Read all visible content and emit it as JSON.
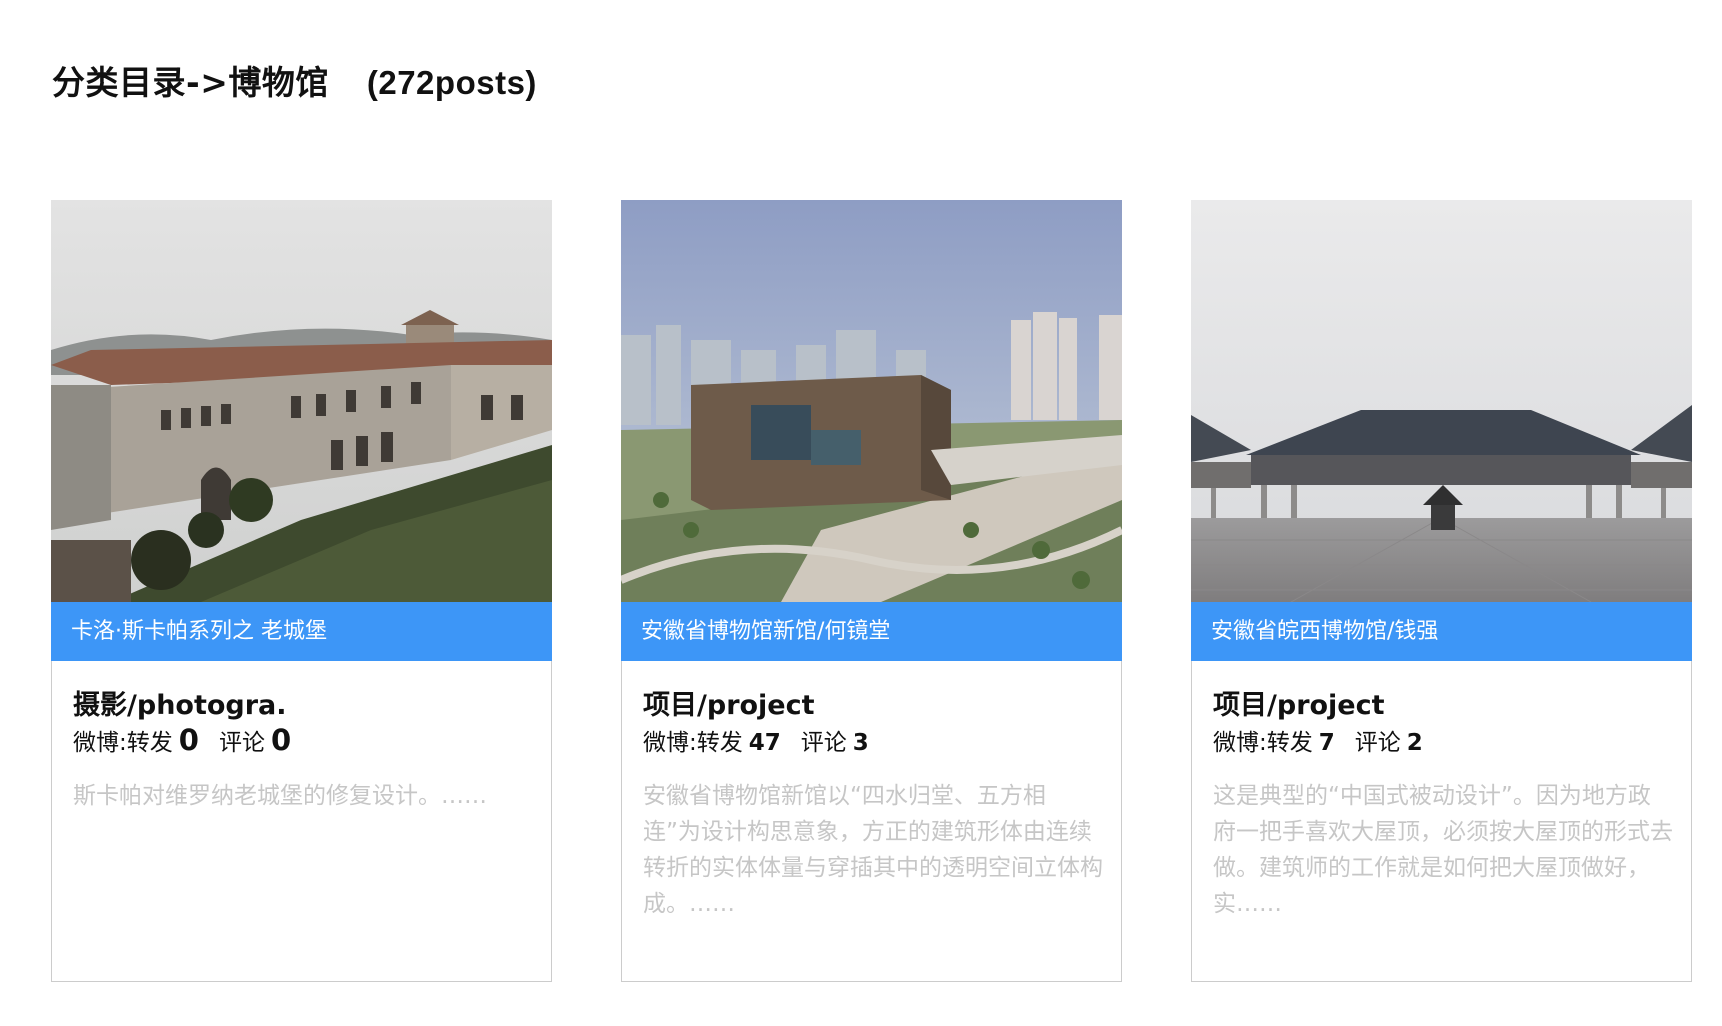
{
  "header": {
    "title": "分类目录->博物馆",
    "count": "(272posts)"
  },
  "cards": [
    {
      "image": "photo-old-castle",
      "caption": "卡洛·斯卡帕系列之 老城堡",
      "category": "摄影/photogra.",
      "weibo_label": "微博:转发",
      "reposts": "0",
      "comment_label": "评论",
      "comments": "0",
      "excerpt": "斯卡帕对维罗纳老城堡的修复设计。……"
    },
    {
      "image": "photo-anhui-museum",
      "caption": "安徽省博物馆新馆/何镜堂",
      "category": "项目/project",
      "weibo_label": "微博:转发",
      "reposts": "47",
      "comment_label": "评论",
      "comments": "3",
      "excerpt": "安徽省博物馆新馆以“四水归堂、五方相连”为设计构思意象，方正的建筑形体由连续转折的实体体量与穿插其中的透明空间立体构成。……"
    },
    {
      "image": "photo-wanxi-museum",
      "caption": "安徽省皖西博物馆/钱强",
      "category": "项目/project",
      "weibo_label": "微博:转发",
      "reposts": "7",
      "comment_label": "评论",
      "comments": "2",
      "excerpt": "这是典型的“中国式被动设计”。因为地方政府一把手喜欢大屋顶，必须按大屋顶的形式去做。建筑师的工作就是如何把大屋顶做好，实……"
    }
  ],
  "colors": {
    "caption_bg": "#3d96f7",
    "excerpt_text": "#c6c6c6",
    "card_border": "#cccccc"
  }
}
